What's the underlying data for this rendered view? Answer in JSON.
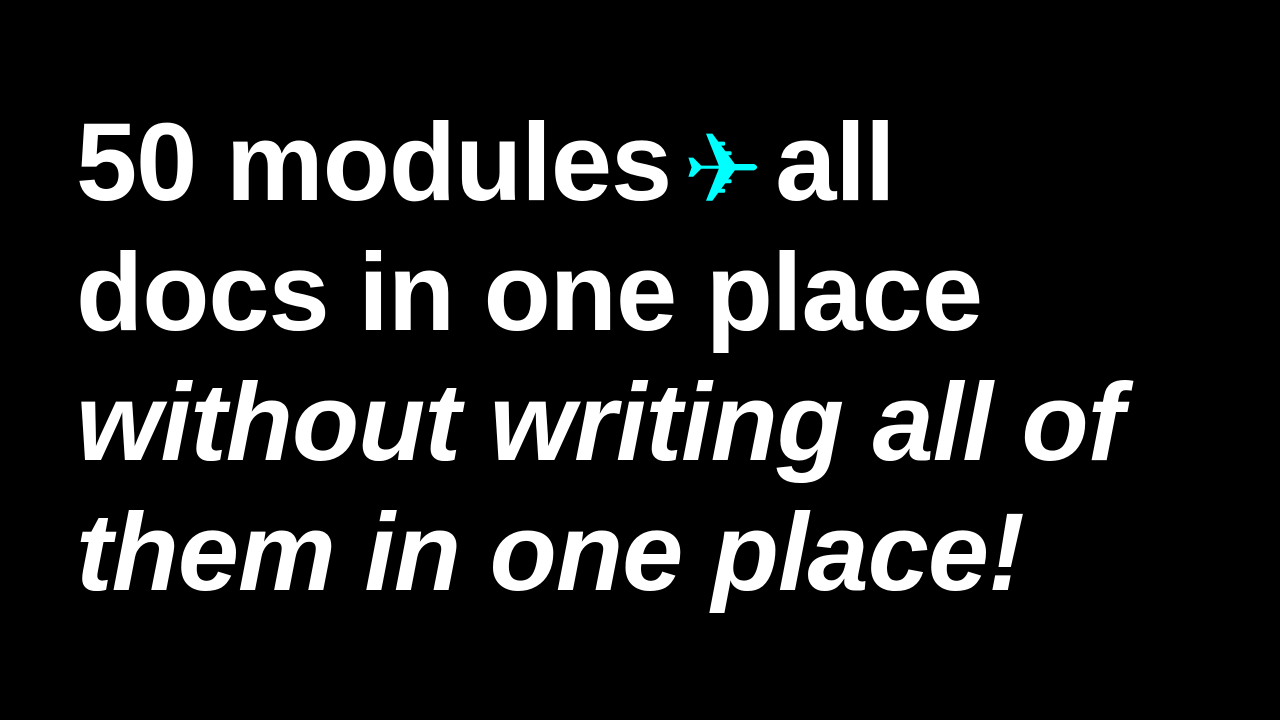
{
  "slide": {
    "line1_before": "50 modules",
    "line1_after": "all",
    "icon": "airplane-icon",
    "icon_color": "#00FFFF",
    "line2": "docs in one place",
    "line3": "without writing all of",
    "line4": "them in one place!"
  }
}
